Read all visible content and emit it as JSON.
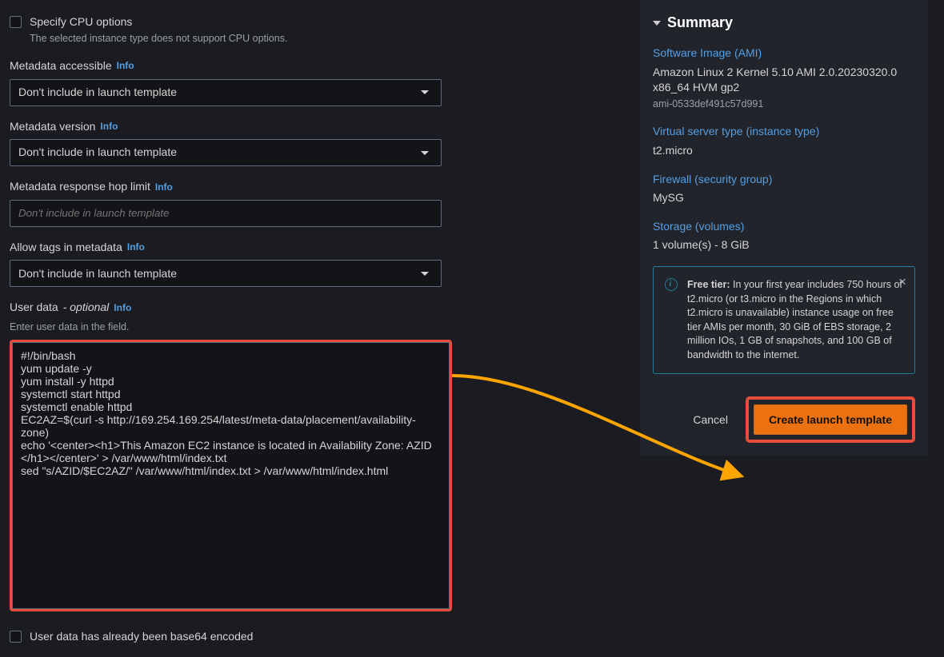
{
  "cpu_options": {
    "label": "Specify CPU options",
    "helper": "The selected instance type does not support CPU options."
  },
  "metadata_accessible": {
    "label": "Metadata accessible",
    "info": "Info",
    "value": "Don't include in launch template"
  },
  "metadata_version": {
    "label": "Metadata version",
    "info": "Info",
    "value": "Don't include in launch template"
  },
  "metadata_hop": {
    "label": "Metadata response hop limit",
    "info": "Info",
    "placeholder": "Don't include in launch template"
  },
  "allow_tags": {
    "label": "Allow tags in metadata",
    "info": "Info",
    "value": "Don't include in launch template"
  },
  "user_data": {
    "label": "User data",
    "optional": "- optional",
    "info": "Info",
    "helper": "Enter user data in the field.",
    "value": "#!/bin/bash\nyum update -y\nyum install -y httpd\nsystemctl start httpd\nsystemctl enable httpd\nEC2AZ=$(curl -s http://169.254.169.254/latest/meta-data/placement/availability-zone)\necho '<center><h1>This Amazon EC2 instance is located in Availability Zone: AZID </h1></center>' > /var/www/html/index.txt\nsed \"s/AZID/$EC2AZ/\" /var/www/html/index.txt > /var/www/html/index.html"
  },
  "base64": {
    "label": "User data has already been base64 encoded"
  },
  "summary": {
    "title": "Summary",
    "ami": {
      "label": "Software Image (AMI)",
      "line1": "Amazon Linux 2 Kernel 5.10 AMI 2.0.20230320.0",
      "line2": "x86_64 HVM gp2",
      "id": "ami-0533def491c57d991"
    },
    "instance_type": {
      "label": "Virtual server type (instance type)",
      "value": "t2.micro"
    },
    "sg": {
      "label": "Firewall (security group)",
      "value": "MySG"
    },
    "storage": {
      "label": "Storage (volumes)",
      "value": "1 volume(s) - 8 GiB"
    },
    "freetier": {
      "bold": "Free tier:",
      "text": " In your first year includes 750 hours of t2.micro (or t3.micro in the Regions in which t2.micro is unavailable) instance usage on free tier AMIs per month, 30 GiB of EBS storage, 2 million IOs, 1 GB of snapshots, and 100 GB of bandwidth to the internet."
    },
    "actions": {
      "cancel": "Cancel",
      "create": "Create launch template"
    }
  }
}
